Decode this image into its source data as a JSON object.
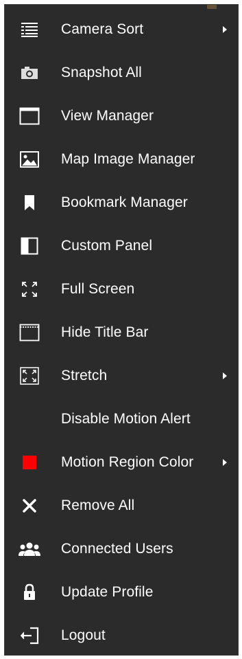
{
  "menu": {
    "items": [
      {
        "label": "Camera Sort",
        "icon": "list-icon",
        "submenu": true
      },
      {
        "label": "Snapshot All",
        "icon": "camera-icon",
        "submenu": false
      },
      {
        "label": "View Manager",
        "icon": "window-icon",
        "submenu": false
      },
      {
        "label": "Map Image Manager",
        "icon": "image-icon",
        "submenu": false
      },
      {
        "label": "Bookmark Manager",
        "icon": "bookmark-icon",
        "submenu": false
      },
      {
        "label": "Custom Panel",
        "icon": "panel-icon",
        "submenu": false
      },
      {
        "label": "Full Screen",
        "icon": "fullscreen-icon",
        "submenu": false
      },
      {
        "label": "Hide Title Bar",
        "icon": "title-bar-icon",
        "submenu": false
      },
      {
        "label": "Stretch",
        "icon": "stretch-icon",
        "submenu": true
      },
      {
        "label": "Disable Motion Alert",
        "icon": "",
        "submenu": false
      },
      {
        "label": "Motion Region Color",
        "icon": "color-swatch-icon",
        "submenu": true
      },
      {
        "label": "Remove All",
        "icon": "close-icon",
        "submenu": false
      },
      {
        "label": "Connected Users",
        "icon": "users-icon",
        "submenu": false
      },
      {
        "label": "Update Profile",
        "icon": "lock-icon",
        "submenu": false
      },
      {
        "label": "Logout",
        "icon": "logout-icon",
        "submenu": false
      }
    ]
  },
  "colors": {
    "menu_background": "#2b2b2b",
    "text": "#ffffff",
    "motion_region_color": "#ff0000"
  }
}
